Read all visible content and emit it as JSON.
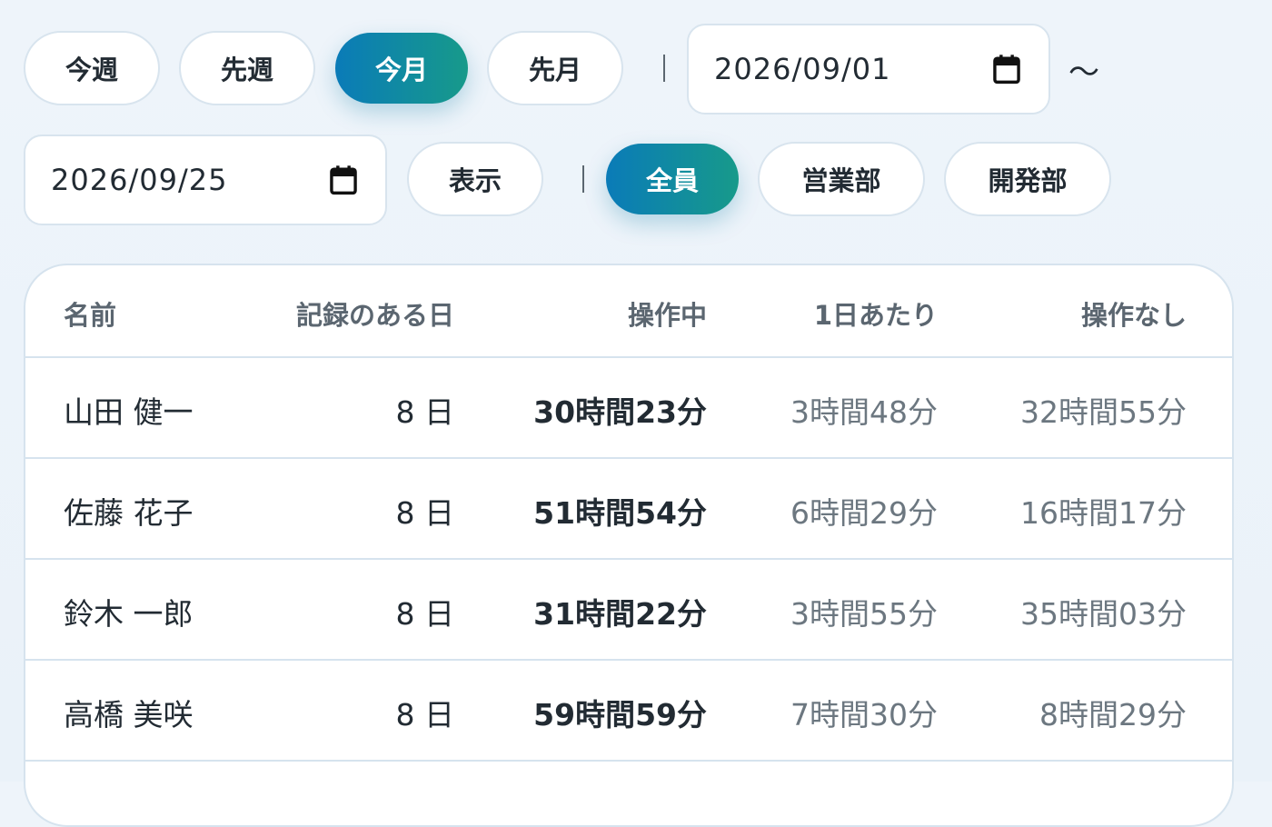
{
  "filters": {
    "periods": [
      "今週",
      "先週",
      "今月",
      "先月"
    ],
    "active_period": "今月",
    "start_date": "2026/09/01",
    "range_separator": "〜",
    "end_date": "2026/09/25",
    "show_label": "表示",
    "groups": [
      "全員",
      "営業部",
      "開発部"
    ],
    "active_group": "全員"
  },
  "table": {
    "headers": {
      "name": "名前",
      "days": "記録のある日",
      "active": "操作中",
      "per_day": "1日あたり",
      "idle": "操作なし"
    },
    "rows": [
      {
        "name": "山田 健一",
        "days": "8 日",
        "active": "30時間23分",
        "per_day": "3時間48分",
        "idle": "32時間55分"
      },
      {
        "name": "佐藤 花子",
        "days": "8 日",
        "active": "51時間54分",
        "per_day": "6時間29分",
        "idle": "16時間17分"
      },
      {
        "name": "鈴木 一郎",
        "days": "8 日",
        "active": "31時間22分",
        "per_day": "3時間55分",
        "idle": "35時間03分"
      },
      {
        "name": "高橋 美咲",
        "days": "8 日",
        "active": "59時間59分",
        "per_day": "7時間30分",
        "idle": "8時間29分"
      }
    ]
  },
  "colors": {
    "accent_start": "#0a7bb8",
    "accent_end": "#179a8a",
    "background": "#eef4fa"
  },
  "icons": {
    "calendar": "calendar-icon"
  }
}
